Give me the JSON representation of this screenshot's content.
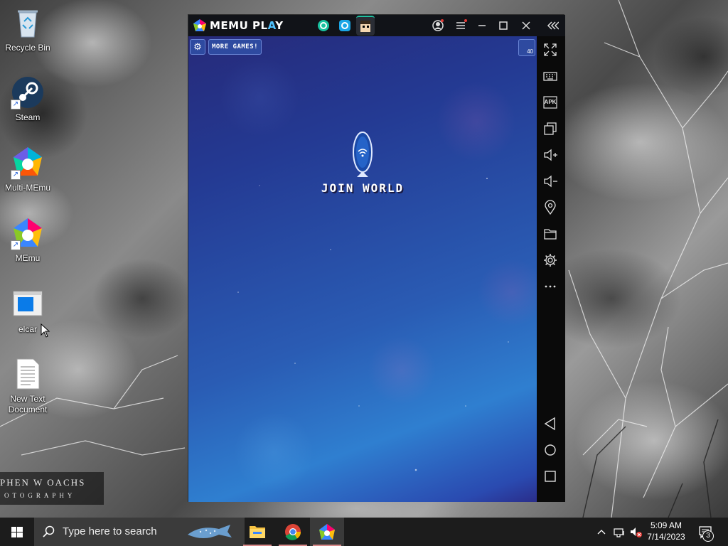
{
  "desktop": {
    "icons": [
      {
        "label": "Recycle Bin",
        "icon": "recycle-bin-icon"
      },
      {
        "label": "Steam",
        "icon": "steam-icon"
      },
      {
        "label": "Multi-MEmu",
        "icon": "multi-memu-icon"
      },
      {
        "label": "MEmu",
        "icon": "memu-icon"
      },
      {
        "label": "elcar",
        "icon": "application-window-icon"
      },
      {
        "label": "New Text Document",
        "icon": "text-document-icon"
      }
    ],
    "watermark_line1": "PHEN W OACHS",
    "watermark_line2": "OTOGRAPHY"
  },
  "memu": {
    "logo_text": "MEMU PL",
    "logo_text_accent": "A",
    "logo_text_end": "Y",
    "titlebar_icons": [
      "account-icon",
      "menu-icon",
      "minimize-icon",
      "maximize-icon",
      "close-icon",
      "collapse-icon"
    ],
    "tabs": [
      "app-tab-icon",
      "app-tab-icon",
      "game-tab-icon"
    ],
    "game": {
      "more_games_label": "MORE GAMES!",
      "corner_badge": "40",
      "join_world_label": "JOIN WORLD"
    },
    "sidebar": [
      "fullscreen-icon",
      "keyboard-icon",
      "apk-icon",
      "multi-window-icon",
      "volume-up-icon",
      "volume-down-icon",
      "location-icon",
      "folder-icon",
      "settings-icon",
      "more-icon",
      "back-icon",
      "home-icon",
      "recents-icon"
    ],
    "sidebar_apk_label": "APK"
  },
  "taskbar": {
    "search_placeholder": "Type here to search",
    "time": "5:09 AM",
    "date": "7/14/2023",
    "notification_count": "3"
  },
  "colors": {
    "taskbar_bg": "#1c1c1c",
    "search_bg": "#3b3b3b",
    "memu_accent": "#4fc3ff",
    "game_bg_top": "#262a7a",
    "game_bg_mid": "#2f7fd0"
  }
}
